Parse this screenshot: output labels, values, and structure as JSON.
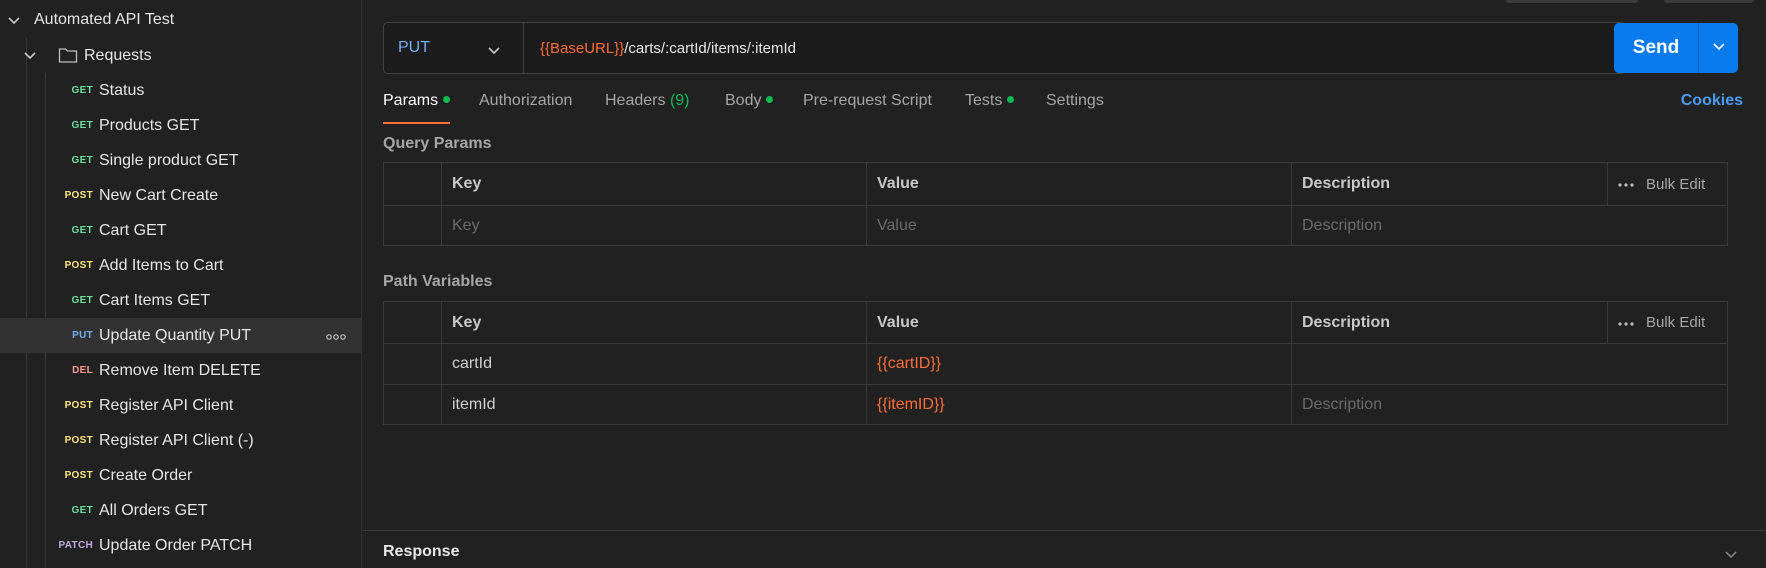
{
  "sidebar": {
    "collection": "Automated API Test",
    "folder": "Requests",
    "requests": [
      {
        "method": "GET",
        "name": "Status"
      },
      {
        "method": "GET",
        "name": "Products GET"
      },
      {
        "method": "GET",
        "name": "Single product GET"
      },
      {
        "method": "POST",
        "name": "New Cart Create"
      },
      {
        "method": "GET",
        "name": "Cart GET"
      },
      {
        "method": "POST",
        "name": "Add Items to Cart"
      },
      {
        "method": "GET",
        "name": "Cart Items GET"
      },
      {
        "method": "PUT",
        "name": "Update Quantity PUT"
      },
      {
        "method": "DEL",
        "name": "Remove Item DELETE"
      },
      {
        "method": "POST",
        "name": "Register API Client"
      },
      {
        "method": "POST",
        "name": "Register API Client (-)"
      },
      {
        "method": "POST",
        "name": "Create Order"
      },
      {
        "method": "GET",
        "name": "All Orders GET"
      },
      {
        "method": "PATCH",
        "name": "Update Order PATCH"
      }
    ]
  },
  "request": {
    "method": "PUT",
    "url_var": "{{BaseURL}}",
    "url_path": "/carts/:cartId/items/:itemId",
    "send_label": "Send"
  },
  "tabs": {
    "params": "Params",
    "authorization": "Authorization",
    "headers": "Headers",
    "headers_count": "(9)",
    "body": "Body",
    "prerequest": "Pre-request Script",
    "tests": "Tests",
    "settings": "Settings",
    "cookies": "Cookies"
  },
  "query_params": {
    "title": "Query Params",
    "headers": {
      "key": "Key",
      "value": "Value",
      "description": "Description",
      "bulk": "Bulk Edit"
    },
    "placeholders": {
      "key": "Key",
      "value": "Value",
      "description": "Description"
    }
  },
  "path_variables": {
    "title": "Path Variables",
    "headers": {
      "key": "Key",
      "value": "Value",
      "description": "Description",
      "bulk": "Bulk Edit"
    },
    "rows": [
      {
        "key": "cartId",
        "value": "{{cartID}}",
        "description": ""
      },
      {
        "key": "itemId",
        "value": "{{itemID}}",
        "description": "Description"
      }
    ]
  },
  "response": {
    "title": "Response"
  },
  "colors": {
    "accent": "#ff6c37",
    "send": "#097bed",
    "get": "#6bdd9a",
    "post": "#ffe47e",
    "put": "#74aef6",
    "del": "#f79a8e",
    "patch": "#c0a8e1"
  }
}
